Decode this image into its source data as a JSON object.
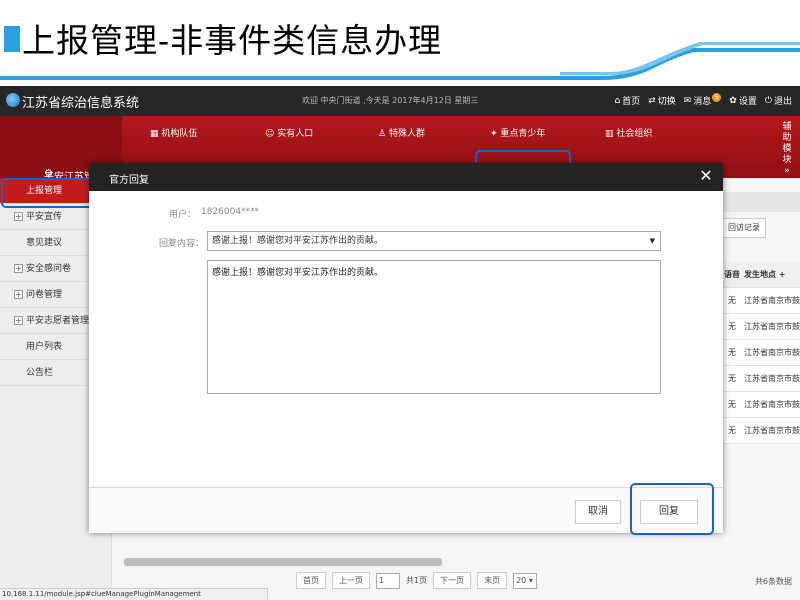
{
  "slide": {
    "title": "上报管理-非事件类信息办理"
  },
  "header": {
    "app_title": "江苏省综治信息系统",
    "welcome": "欢迎 中央门街道 ,今天是 2017年4月12日 星期三",
    "actions": {
      "home": "首页",
      "switch": "切换",
      "messages": "消息",
      "messages_badge": "5",
      "settings": "设置",
      "logout": "退出"
    }
  },
  "nav": {
    "home_label": "平安江苏管理",
    "items": [
      "机构队伍",
      "实有人口",
      "特殊人群",
      "重点青少年",
      "社会组织"
    ],
    "side_label": "辅助模块"
  },
  "sidebar": {
    "items": [
      "上报管理",
      "平安宣传",
      "意见建议",
      "安全感问卷",
      "问卷管理",
      "平安志愿者管理",
      "用户列表",
      "公告栏"
    ]
  },
  "main": {
    "visit_button": "回访记录",
    "columns": [
      "语音",
      "发生地点"
    ],
    "add_column": "+",
    "rows": [
      {
        "voice": "无",
        "location": "江苏省南京市鼓"
      },
      {
        "voice": "无",
        "location": "江苏省南京市鼓"
      },
      {
        "voice": "无",
        "location": "江苏省南京市鼓"
      },
      {
        "voice": "无",
        "location": "江苏省南京市鼓"
      },
      {
        "voice": "无",
        "location": "江苏省南京市鼓"
      },
      {
        "voice": "无",
        "location": "江苏省南京市鼓"
      }
    ],
    "pager": {
      "first": "首页",
      "prev": "上一页",
      "current_page": "1",
      "total_pages": "共1页",
      "next": "下一页",
      "last": "末页",
      "page_size": "20",
      "total": "共6条数据"
    }
  },
  "modal": {
    "title": "官方回复",
    "user_label": "用户：",
    "user_value": "1826004****",
    "reply_label": "回复内容：",
    "reply_selected": "感谢上报！感谢您对平安江苏作出的贡献。",
    "reply_text": "感谢上报！感谢您对平安江苏作出的贡献。",
    "cancel": "取消",
    "submit": "回复"
  },
  "status_url": "10.168.1.11/module.jsp#clueManagePluginManagement",
  "colors": {
    "accent_red": "#c21b20",
    "header_dark": "#262626",
    "highlight_blue": "#1f5fc4",
    "title_blue": "#2aa0e0"
  }
}
